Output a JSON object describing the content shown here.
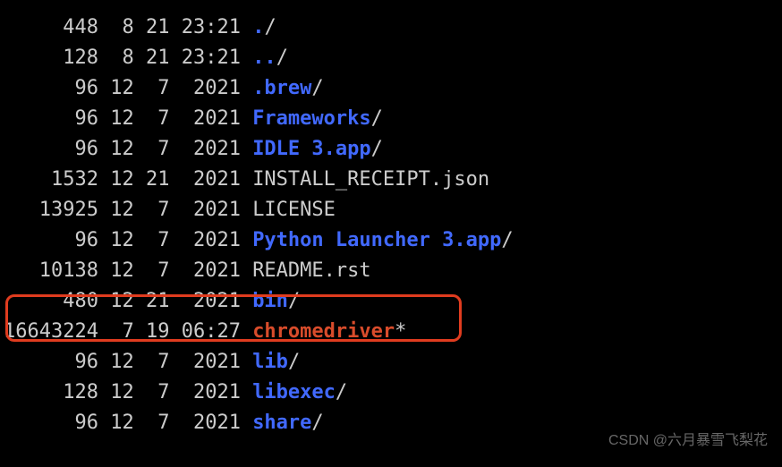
{
  "rows": [
    {
      "size": "448",
      "date": "  8 21 23:21 ",
      "name": ".",
      "type": "dir",
      "suffix": "/"
    },
    {
      "size": "128",
      "date": "  8 21 23:21 ",
      "name": "..",
      "type": "dir",
      "suffix": "/"
    },
    {
      "size": "96",
      "date": " 12  7  2021 ",
      "name": ".brew",
      "type": "dir",
      "suffix": "/"
    },
    {
      "size": "96",
      "date": " 12  7  2021 ",
      "name": "Frameworks",
      "type": "dir",
      "suffix": "/"
    },
    {
      "size": "96",
      "date": " 12  7  2021 ",
      "name": "IDLE 3.app",
      "type": "dir",
      "suffix": "/"
    },
    {
      "size": "1532",
      "date": " 12 21  2021 ",
      "name": "INSTALL_RECEIPT.json",
      "type": "plain",
      "suffix": ""
    },
    {
      "size": "13925",
      "date": " 12  7  2021 ",
      "name": "LICENSE",
      "type": "plain",
      "suffix": ""
    },
    {
      "size": "96",
      "date": " 12  7  2021 ",
      "name": "Python Launcher 3.app",
      "type": "dir",
      "suffix": "/"
    },
    {
      "size": "10138",
      "date": " 12  7  2021 ",
      "name": "README.rst",
      "type": "plain",
      "suffix": ""
    },
    {
      "size": "480",
      "date": " 12 21  2021 ",
      "name": "bin",
      "type": "dir",
      "suffix": "/"
    },
    {
      "size": "16643224",
      "date": "  7 19 06:27 ",
      "name": "chromedriver",
      "type": "exec",
      "suffix": "*"
    },
    {
      "size": "96",
      "date": " 12  7  2021 ",
      "name": "lib",
      "type": "dir",
      "suffix": "/"
    },
    {
      "size": "128",
      "date": " 12  7  2021 ",
      "name": "libexec",
      "type": "dir",
      "suffix": "/"
    },
    {
      "size": "96",
      "date": " 12  7  2021 ",
      "name": "share",
      "type": "dir",
      "suffix": "/"
    }
  ],
  "watermark": "CSDN @六月暴雪飞梨花"
}
